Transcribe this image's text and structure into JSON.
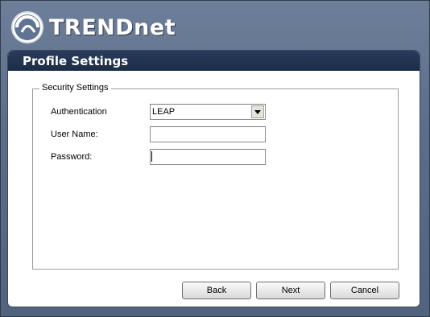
{
  "brand": {
    "name": "TRENDnet"
  },
  "panel": {
    "title": "Profile Settings"
  },
  "security": {
    "legend": "Security Settings",
    "authentication": {
      "label": "Authentication",
      "value": "LEAP"
    },
    "username": {
      "label": "User Name:",
      "value": ""
    },
    "password": {
      "label": "Password:",
      "value": ""
    }
  },
  "buttons": {
    "back": "Back",
    "next": "Next",
    "cancel": "Cancel"
  }
}
